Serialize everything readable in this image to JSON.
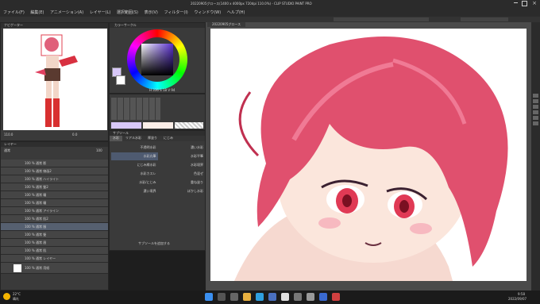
{
  "window": {
    "title": "20220905グロース(1400 x 4000px 720dpi 110.0%) - CLIP STUDIO PAINT PRO"
  },
  "menu": [
    "ファイル(F)",
    "編集(E)",
    "アニメーション(A)",
    "レイヤー(L)",
    "選択範囲(S)",
    "表示(V)",
    "フィルター(I)",
    "ウィンドウ(W)",
    "ヘルプ(H)"
  ],
  "navigator": {
    "title": "ナビゲーター",
    "zoom": "110.0",
    "angle": "0.0"
  },
  "color_panel": {
    "title": "カラーサークル",
    "hsv": "H 336 S 18 V 94",
    "accent": "#d8c8f8"
  },
  "subtool": {
    "title": "サブツール",
    "tabs": [
      "水彩",
      "リアル水彩",
      "厚塗り",
      "にじみ"
    ],
    "brushes": [
      "不透明水彩",
      "濃い水彩",
      "水彩丸筆",
      "水彩平筆",
      "にじみ縁水彩",
      "水彩境界",
      "水彩カスレ",
      "色混ぜ",
      "水彩/にじみ",
      "重ね塗り",
      "濃い境界",
      "ぼかし水彩"
    ],
    "add_label": "サブツールを追加する"
  },
  "layers": {
    "title": "レイヤー",
    "blend": "通常",
    "opacity": "100",
    "items": [
      "100 % 通常 影",
      "100 % 通常 線画2",
      "100 % 通常 ハイライト",
      "100 % 通常 髪2",
      "100 % 通常 瞳",
      "100 % 通常 瞳",
      "100 % 通常 アイライン",
      "100 % 通常 肌2",
      "100 % 通常 服",
      "100 % 通常 髪",
      "100 % 通常 眉",
      "100 % 通常 肌",
      "100 % 通常 レイヤー",
      "100 % 通常 用紙"
    ],
    "selected": 8
  },
  "canvas": {
    "tab": "20220905グロース"
  },
  "taskbar": {
    "weather_temp": "22°C",
    "weather_text": "晴れ",
    "time": "9:58",
    "date": "2022/09/07"
  }
}
